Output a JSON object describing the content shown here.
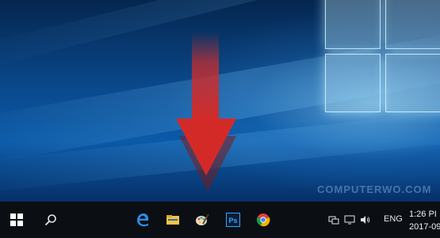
{
  "desktop": {
    "watermark": "COMPUTERWO.COM"
  },
  "arrow": {
    "color": "#d42a27",
    "direction": "down",
    "points_to": "paint-app-icon"
  },
  "taskbar": {
    "background": "#0b0f14",
    "pinned": [
      {
        "name": "start-button",
        "icon": "windows-logo-icon"
      },
      {
        "name": "search-button",
        "icon": "search-icon"
      },
      {
        "name": "edge",
        "icon": "edge-icon",
        "color": "#2f8de4"
      },
      {
        "name": "file-explorer",
        "icon": "folder-icon",
        "color": "#f5c342"
      },
      {
        "name": "paint",
        "icon": "paint-palette-icon"
      },
      {
        "name": "photoshop",
        "icon": "photoshop-icon",
        "label": "Ps",
        "color": "#31a8ff"
      },
      {
        "name": "chrome",
        "icon": "chrome-icon"
      }
    ],
    "tray": {
      "icons": [
        "network-icon",
        "action-center-icon",
        "volume-icon"
      ],
      "language": "ENG",
      "time": "1:26 PI",
      "date": "2017-09"
    }
  }
}
